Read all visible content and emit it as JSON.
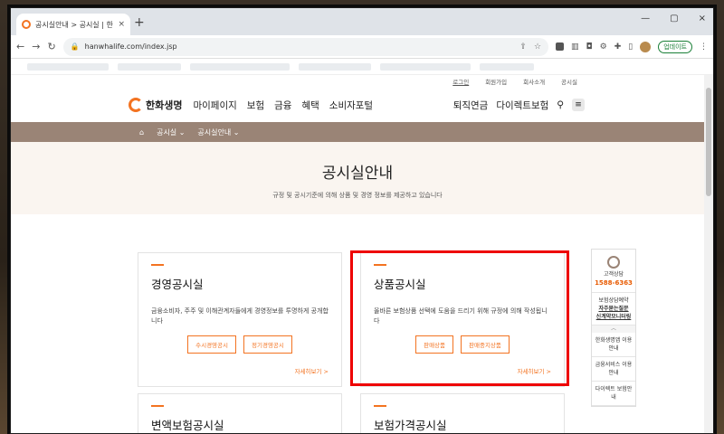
{
  "browser": {
    "tab_title": "공시실안내 > 공시실 | 한화생명",
    "tab_close": "×",
    "new_tab": "+",
    "window_controls": [
      "—",
      "▢",
      "×"
    ],
    "url": "hanwhalife.com/index.jsp",
    "update_label": "업데이트"
  },
  "util_links": [
    "로그인",
    "회원가입",
    "회사소개",
    "공시실"
  ],
  "header": {
    "logo": "한화생명",
    "menu": [
      "마이페이지",
      "보험",
      "금융",
      "혜택",
      "소비자포털"
    ],
    "right_menu": [
      "퇴직연금",
      "다이렉트보험"
    ]
  },
  "location": {
    "home_icon": "home-icon",
    "items": [
      "공시실",
      "공시실안내"
    ]
  },
  "hero": {
    "title": "공시실안내",
    "desc": "규정 및 공시기준에 의해 상품 및 경영 정보를 제공하고 있습니다"
  },
  "cards": [
    {
      "title": "경영공시실",
      "desc": "금융소비자, 주주 및 이해관계자들에게 경영정보를 투명하게 공개합니다",
      "buttons": [
        "수시경영공시",
        "정기경영공시"
      ],
      "more": "자세히보기 >"
    },
    {
      "title": "상품공시실",
      "desc": "올바른 보험상품 선택에 도움을 드리기 위해 규정에 의해 작성됩니다",
      "buttons": [
        "판매상품",
        "판매중지상품"
      ],
      "more": "자세히보기 >"
    },
    {
      "title": "변액보험공시실"
    },
    {
      "title": "보험가격공시실"
    }
  ],
  "quick": {
    "label": "고객상담",
    "tel": "1588-6363",
    "links": [
      "보험상담예약",
      "자주묻는질문",
      "신계약모니터링"
    ],
    "more_links": [
      "한화생명앱 이용안내",
      "금융서비스 이용안내",
      "다이렉트 보험안내"
    ]
  }
}
